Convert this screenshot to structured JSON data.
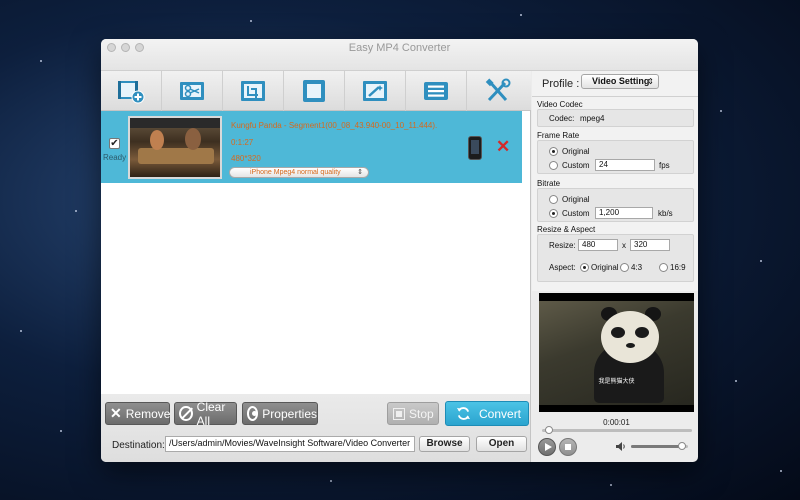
{
  "window": {
    "title": "Easy MP4 Converter"
  },
  "toolbar": {
    "tools": [
      {
        "icon": "add-video-icon"
      },
      {
        "icon": "trim-icon"
      },
      {
        "icon": "crop-icon"
      },
      {
        "icon": "frame-icon"
      },
      {
        "icon": "effects-icon"
      },
      {
        "icon": "menu-list-icon"
      },
      {
        "icon": "settings-tools-icon"
      }
    ]
  },
  "file": {
    "status": "Ready",
    "checked": true,
    "name": "Kungfu Panda - Segment1(00_08_43.940-00_10_11.444).",
    "duration": "0:1:27",
    "resolution": "480*320",
    "output_profile": "iPhone Mpeg4 normal quality",
    "device_icon": "iphone-icon",
    "remove_icon": "delete-x-icon"
  },
  "actions": {
    "remove": "Remove",
    "clear_all": "Clear All",
    "properties": "Properties",
    "stop": "Stop",
    "convert": "Convert"
  },
  "destination": {
    "label": "Destination:",
    "path": "/Users/admin/Movies/WaveInsight Software/Video Converter",
    "browse": "Browse",
    "open": "Open"
  },
  "settings": {
    "profile_label": "Profile :",
    "profile_value": "Video Setting",
    "video_codec": {
      "title": "Video Codec",
      "codec_label": "Codec:",
      "codec_value": "mpeg4"
    },
    "frame_rate": {
      "title": "Frame Rate",
      "original": "Original",
      "custom": "Custom",
      "value": "24",
      "unit": "fps",
      "selected": "original"
    },
    "bitrate": {
      "title": "Bitrate",
      "original": "Original",
      "custom": "Custom",
      "value": "1,200",
      "unit": "kb/s",
      "selected": "custom"
    },
    "resize": {
      "title": "Resize & Aspect",
      "resize_label": "Resize:",
      "width": "480",
      "sep": "x",
      "height": "320",
      "aspect_label": "Aspect:",
      "aspect_original": "Original",
      "aspect_43": "4:3",
      "aspect_169": "16:9",
      "selected": "original"
    }
  },
  "preview": {
    "time": "0:00:01",
    "caption": "我是熊猫大侠",
    "seek_position": 0.02,
    "volume": 0.95
  },
  "colors": {
    "selection": "#4eb8d7",
    "file_text": "#d66a1d",
    "convert": "#2ba4cf",
    "remove_x": "#d42a2a"
  }
}
